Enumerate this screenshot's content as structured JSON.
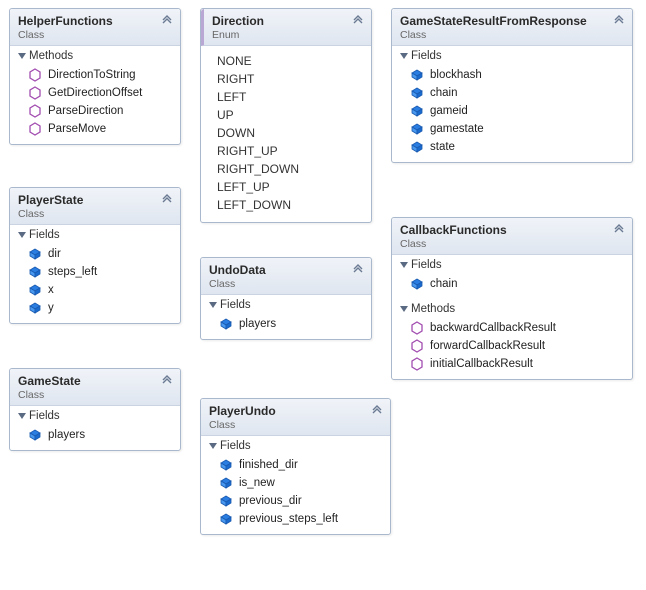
{
  "section_labels": {
    "fields": "Fields",
    "methods": "Methods"
  },
  "boxes": {
    "helperFunctions": {
      "title": "HelperFunctions",
      "stereotype": "Class",
      "methods": [
        "DirectionToString",
        "GetDirectionOffset",
        "ParseDirection",
        "ParseMove"
      ]
    },
    "playerState": {
      "title": "PlayerState",
      "stereotype": "Class",
      "fields": [
        "dir",
        "steps_left",
        "x",
        "y"
      ]
    },
    "gameState": {
      "title": "GameState",
      "stereotype": "Class",
      "fields": [
        "players"
      ]
    },
    "direction": {
      "title": "Direction",
      "stereotype": "Enum",
      "values": [
        "NONE",
        "RIGHT",
        "LEFT",
        "UP",
        "DOWN",
        "RIGHT_UP",
        "RIGHT_DOWN",
        "LEFT_UP",
        "LEFT_DOWN"
      ]
    },
    "undoData": {
      "title": "UndoData",
      "stereotype": "Class",
      "fields": [
        "players"
      ]
    },
    "playerUndo": {
      "title": "PlayerUndo",
      "stereotype": "Class",
      "fields": [
        "finished_dir",
        "is_new",
        "previous_dir",
        "previous_steps_left"
      ]
    },
    "gameStateResult": {
      "title": "GameStateResultFromResponse",
      "stereotype": "Class",
      "fields": [
        "blockhash",
        "chain",
        "gameid",
        "gamestate",
        "state"
      ]
    },
    "callbackFunctions": {
      "title": "CallbackFunctions",
      "stereotype": "Class",
      "fields": [
        "chain"
      ],
      "methods": [
        "backwardCallbackResult",
        "forwardCallbackResult",
        "initialCallbackResult"
      ]
    }
  }
}
